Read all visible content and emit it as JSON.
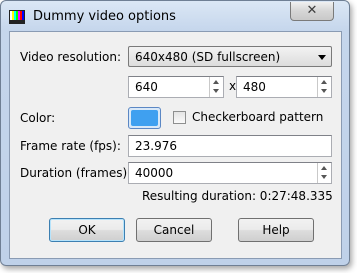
{
  "window": {
    "title": "Dummy video options",
    "close_glyph": "✕"
  },
  "resolution": {
    "label": "Video resolution:",
    "selected": "640x480 (SD fullscreen)",
    "width": "640",
    "separator": "x",
    "height": "480"
  },
  "color": {
    "label": "Color:",
    "value": "#3fa0f0",
    "checkbox_label": "Checkerboard pattern",
    "checkbox_checked": false
  },
  "frame_rate": {
    "label": "Frame rate (fps):",
    "value": "23.976"
  },
  "duration": {
    "label": "Duration (frames):",
    "value": "40000",
    "result": "Resulting duration: 0:27:48.335"
  },
  "buttons": {
    "ok": "OK",
    "cancel": "Cancel",
    "help": "Help"
  }
}
